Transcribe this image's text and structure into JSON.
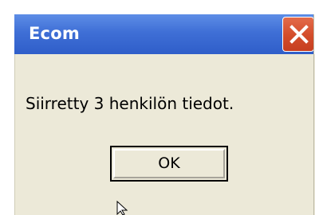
{
  "window": {
    "title": "Ecom",
    "message": "Siirretty 3 henkilön tiedot.",
    "ok_label": "OK",
    "colors": {
      "titlebar": "#3f6fd6",
      "close_button": "#d34c2a",
      "client_background": "#ece9d8"
    },
    "icons": {
      "close": "close-icon",
      "cursor": "mouse-pointer-icon"
    }
  }
}
